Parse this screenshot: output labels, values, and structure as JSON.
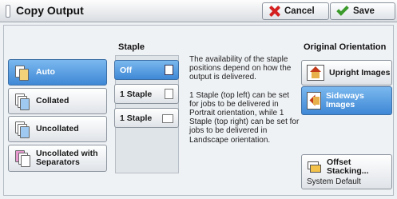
{
  "header": {
    "title": "Copy Output",
    "cancel_label": "Cancel",
    "save_label": "Save"
  },
  "collation": {
    "options": [
      {
        "label": "Auto",
        "selected": true
      },
      {
        "label": "Collated",
        "selected": false
      },
      {
        "label": "Uncollated",
        "selected": false
      },
      {
        "label": "Uncollated with Separators",
        "selected": false
      }
    ]
  },
  "staple": {
    "label": "Staple",
    "options": [
      {
        "label": "Off",
        "selected": true
      },
      {
        "label": "1 Staple",
        "selected": false
      },
      {
        "label": "1 Staple",
        "selected": false
      }
    ]
  },
  "info": {
    "paragraph1": "The availability of the staple positions depend on how the output is delivered.",
    "paragraph2": "1 Staple (top left) can be set for jobs to be delivered in Portrait orientation, while 1 Staple (top right) can be set for jobs to be delivered in Landscape orientation."
  },
  "orientation": {
    "label": "Original Orientation",
    "options": [
      {
        "label": "Upright Images",
        "selected": false
      },
      {
        "label": "Sideways Images",
        "selected": true
      }
    ]
  },
  "offset": {
    "label": "Offset Stacking...",
    "value": "System Default"
  },
  "colors": {
    "selected": "#4a92dc",
    "cancel_icon": "#d42020",
    "save_icon": "#3a9a2a"
  }
}
